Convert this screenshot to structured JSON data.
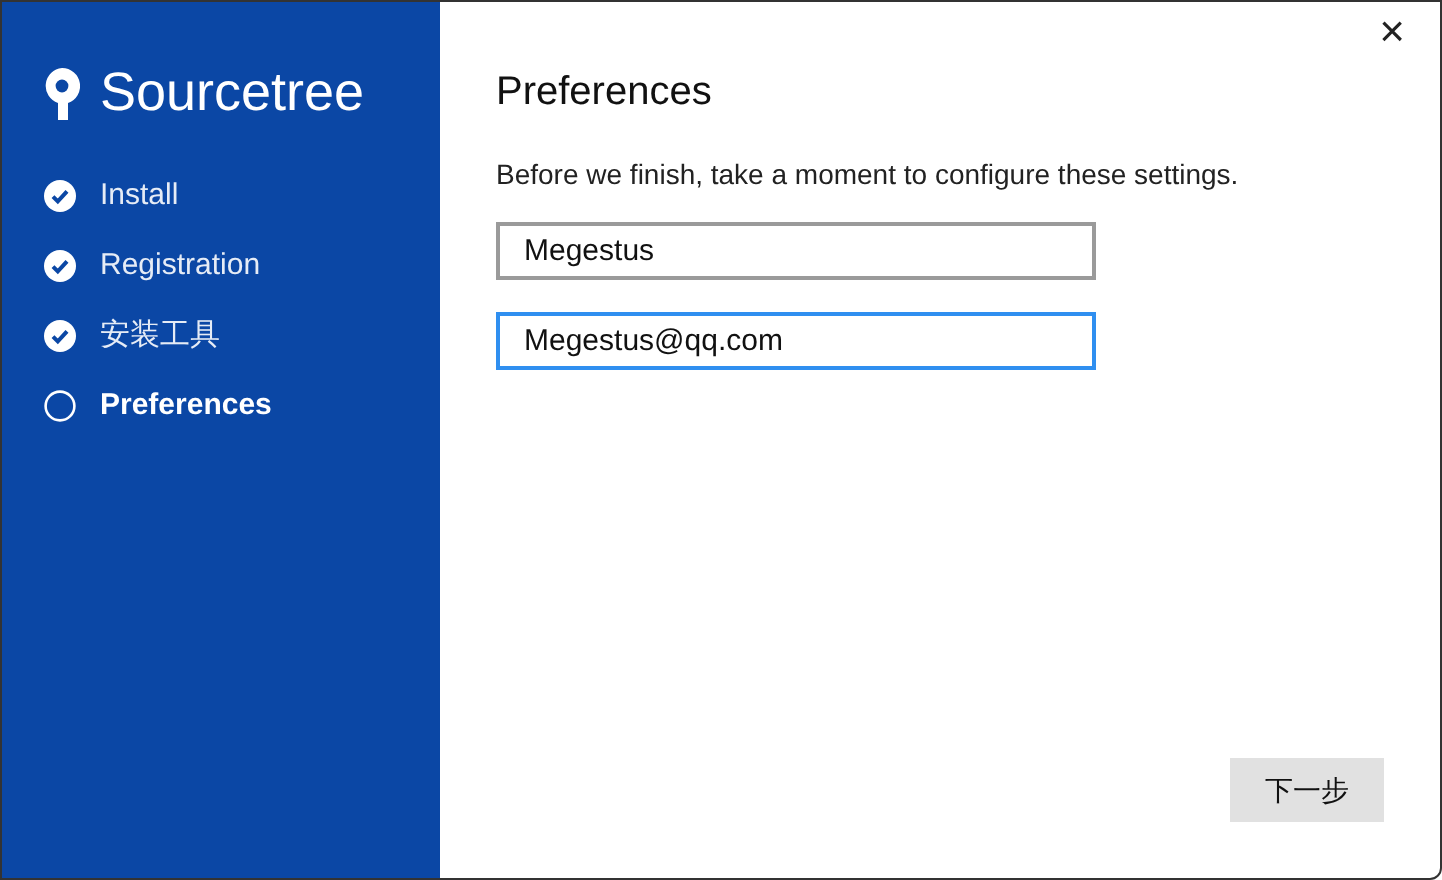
{
  "sidebar": {
    "app_name": "Sourcetree",
    "steps": [
      {
        "label": "Install",
        "done": true,
        "selected": false
      },
      {
        "label": "Registration",
        "done": true,
        "selected": false
      },
      {
        "label": "安装工具",
        "done": true,
        "selected": false
      },
      {
        "label": "Preferences",
        "done": false,
        "selected": true
      }
    ]
  },
  "close_button": "×",
  "title": "Preferences",
  "description": "Before we finish, take a moment to configure these settings.",
  "fields": [
    {
      "value": "Megestus",
      "focused": false
    },
    {
      "value": "Megestus@qq.com",
      "focused": true
    }
  ],
  "next_button": "下一步"
}
